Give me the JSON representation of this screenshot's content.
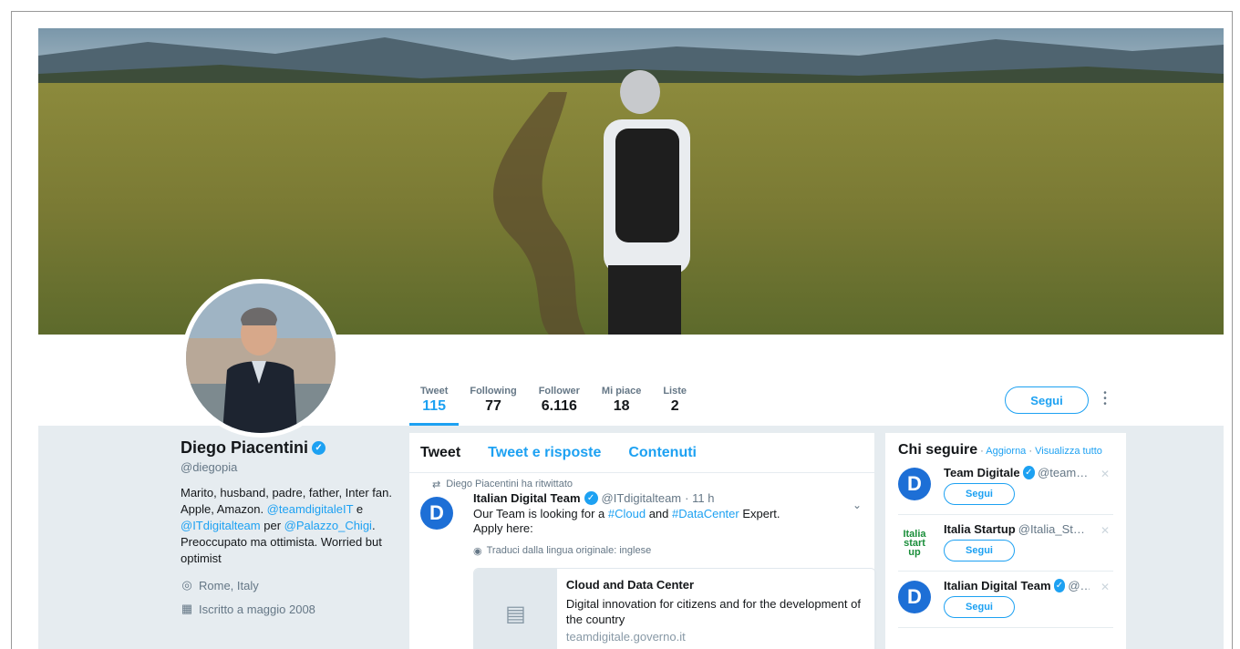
{
  "profile": {
    "name": "Diego Piacentini",
    "handle": "@diegopia",
    "bio_1": "Marito, husband, padre, father, Inter fan. Apple, Amazon. ",
    "bio_link1": "@teamdigitaleIT",
    "bio_2": " e ",
    "bio_link2": "@ITdigitalteam",
    "bio_3": " per ",
    "bio_link3": "@Palazzo_Chigi",
    "bio_4": ". Preoccupato ma ottimista. Worried but optimist",
    "location": "Rome, Italy",
    "joined": "Iscritto a maggio 2008"
  },
  "stats": [
    {
      "label": "Tweet",
      "value": "115"
    },
    {
      "label": "Following",
      "value": "77"
    },
    {
      "label": "Follower",
      "value": "6.116"
    },
    {
      "label": "Mi piace",
      "value": "18"
    },
    {
      "label": "Liste",
      "value": "2"
    }
  ],
  "follow_button": "Segui",
  "tabs": [
    "Tweet",
    "Tweet e risposte",
    "Contenuti"
  ],
  "tweet": {
    "retweet_context": "Diego Piacentini ha ritwittato",
    "avatar_letter": "D",
    "author": "Italian Digital Team",
    "handle": "@ITdigitalteam",
    "time": "· 11 h",
    "text_1": "Our Team is looking for a ",
    "tag_1": "#Cloud",
    "text_2": " and ",
    "tag_2": "#DataCenter",
    "text_3": " Expert.",
    "text_4": "Apply here:",
    "translate": "Traduci dalla lingua originale: inglese",
    "card_title": "Cloud and Data Center",
    "card_desc": "Digital innovation for citizens and for the development of the country",
    "card_domain": "teamdigitale.governo.it"
  },
  "who_to_follow": {
    "title": "Chi seguire",
    "refresh": "Aggiorna",
    "view_all": "Visualizza tutto",
    "separator": "·",
    "items": [
      {
        "name": "Team Digitale",
        "handle": "@teamdi...",
        "button": "Segui",
        "avatar": "D"
      },
      {
        "name": "Italia Startup",
        "handle": "@Italia_Star...",
        "button": "Segui",
        "avatar": "Italia start up"
      },
      {
        "name": "Italian Digital Team",
        "handle": "@I...",
        "button": "Segui",
        "avatar": "D"
      }
    ]
  },
  "icons": {
    "verified": "verified-badge-icon",
    "location": "location-pin-icon",
    "calendar": "calendar-icon",
    "retweet": "retweet-icon",
    "globe": "globe-icon",
    "more": "more-vertical-icon",
    "chevron": "chevron-down-icon",
    "close": "close-icon",
    "document": "document-icon"
  },
  "colors": {
    "accent": "#1da1f2",
    "background": "#e6ecf0",
    "text": "#14171a",
    "secondary": "#657786"
  }
}
